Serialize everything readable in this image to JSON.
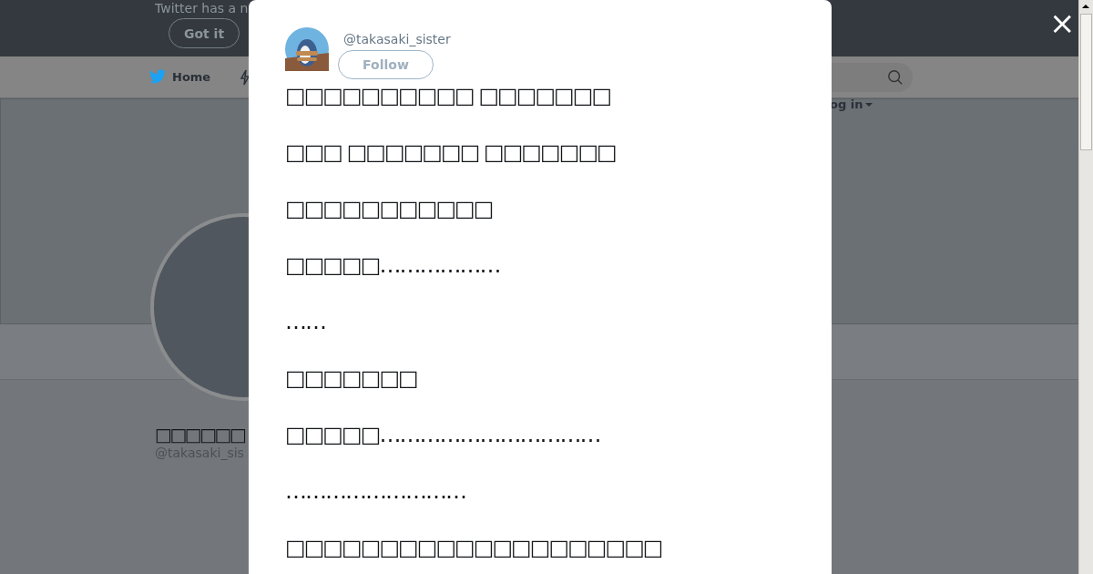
{
  "page": {
    "notice": "Twitter has a n",
    "notice_button": "Got it",
    "nav": {
      "home": "Home",
      "login": "og in"
    },
    "profile": {
      "name": "□□□□□□",
      "handle": "@takasaki_sis"
    }
  },
  "modal": {
    "handle": "@takasaki_sister",
    "follow": "Follow",
    "close": "×",
    "lines": [
      "□□□□□□□□□□ □□□□□□□",
      "□□□ □□□□□□□ □□□□□□□",
      "□□□□□□□□□□□",
      "□□□□□………………",
      "……",
      "□□□□□□□",
      "□□□□□……………………………",
      "………………………",
      "□□□□□□□□□□□□□□□□□□□□"
    ]
  }
}
